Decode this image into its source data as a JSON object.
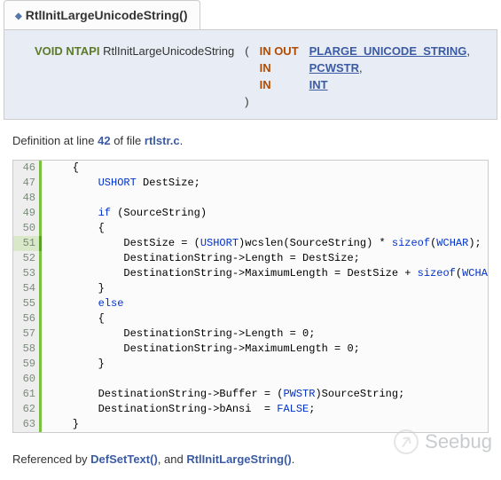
{
  "tab": {
    "diamond": "◆",
    "title": "RtlInitLargeUnicodeString()"
  },
  "signature": {
    "return_kw": "VOID",
    "api_kw": "NTAPI",
    "fn_name": "RtlInitLargeUnicodeString",
    "open": "(",
    "close": ")",
    "params": [
      {
        "dir": "IN OUT",
        "type": "PLARGE_UNICODE_STRING",
        "trail": ","
      },
      {
        "dir": "IN",
        "type": "PCWSTR",
        "trail": ","
      },
      {
        "dir": "IN",
        "type": "INT",
        "trail": ""
      }
    ]
  },
  "definition": {
    "prefix": "Definition at line ",
    "line": "42",
    "mid": " of file ",
    "file": "rtlstr.c",
    "suffix": "."
  },
  "code": {
    "lines": [
      {
        "n": "46",
        "hi": false,
        "tokens": [
          [
            "plain",
            "    {"
          ]
        ]
      },
      {
        "n": "47",
        "hi": false,
        "tokens": [
          [
            "plain",
            "        "
          ],
          [
            "type",
            "USHORT"
          ],
          [
            "plain",
            " DestSize;"
          ]
        ]
      },
      {
        "n": "48",
        "hi": false,
        "tokens": [
          [
            "plain",
            ""
          ]
        ]
      },
      {
        "n": "49",
        "hi": false,
        "tokens": [
          [
            "plain",
            "        "
          ],
          [
            "kw",
            "if"
          ],
          [
            "plain",
            " (SourceString)"
          ]
        ]
      },
      {
        "n": "50",
        "hi": false,
        "tokens": [
          [
            "plain",
            "        {"
          ]
        ]
      },
      {
        "n": "51",
        "hi": true,
        "tokens": [
          [
            "plain",
            "            DestSize = ("
          ],
          [
            "type",
            "USHORT"
          ],
          [
            "plain",
            ")wcslen(SourceString) * "
          ],
          [
            "kw",
            "sizeof"
          ],
          [
            "plain",
            "("
          ],
          [
            "type",
            "WCHAR"
          ],
          [
            "plain",
            ");"
          ]
        ]
      },
      {
        "n": "52",
        "hi": false,
        "tokens": [
          [
            "plain",
            "            DestinationString->Length = DestSize;"
          ]
        ]
      },
      {
        "n": "53",
        "hi": false,
        "tokens": [
          [
            "plain",
            "            DestinationString->MaximumLength = DestSize + "
          ],
          [
            "kw",
            "sizeof"
          ],
          [
            "plain",
            "("
          ],
          [
            "type",
            "WCHAR"
          ],
          [
            "plain",
            ");"
          ]
        ]
      },
      {
        "n": "54",
        "hi": false,
        "tokens": [
          [
            "plain",
            "        }"
          ]
        ]
      },
      {
        "n": "55",
        "hi": false,
        "tokens": [
          [
            "plain",
            "        "
          ],
          [
            "kw",
            "else"
          ]
        ]
      },
      {
        "n": "56",
        "hi": false,
        "tokens": [
          [
            "plain",
            "        {"
          ]
        ]
      },
      {
        "n": "57",
        "hi": false,
        "tokens": [
          [
            "plain",
            "            DestinationString->Length = 0;"
          ]
        ]
      },
      {
        "n": "58",
        "hi": false,
        "tokens": [
          [
            "plain",
            "            DestinationString->MaximumLength = 0;"
          ]
        ]
      },
      {
        "n": "59",
        "hi": false,
        "tokens": [
          [
            "plain",
            "        }"
          ]
        ]
      },
      {
        "n": "60",
        "hi": false,
        "tokens": [
          [
            "plain",
            ""
          ]
        ]
      },
      {
        "n": "61",
        "hi": false,
        "tokens": [
          [
            "plain",
            "        DestinationString->Buffer = ("
          ],
          [
            "type",
            "PWSTR"
          ],
          [
            "plain",
            ")SourceString;"
          ]
        ]
      },
      {
        "n": "62",
        "hi": false,
        "tokens": [
          [
            "plain",
            "        DestinationString->bAnsi  = "
          ],
          [
            "type",
            "FALSE"
          ],
          [
            "plain",
            ";"
          ]
        ]
      },
      {
        "n": "63",
        "hi": false,
        "tokens": [
          [
            "plain",
            "    }"
          ]
        ]
      }
    ]
  },
  "referenced": {
    "prefix": "Referenced by ",
    "items": [
      {
        "label": "DefSetText()"
      },
      {
        "label": "RtlInitLargeString()"
      }
    ],
    "sep": ", and ",
    "suffix": "."
  },
  "watermark": {
    "text": "Seebug"
  }
}
